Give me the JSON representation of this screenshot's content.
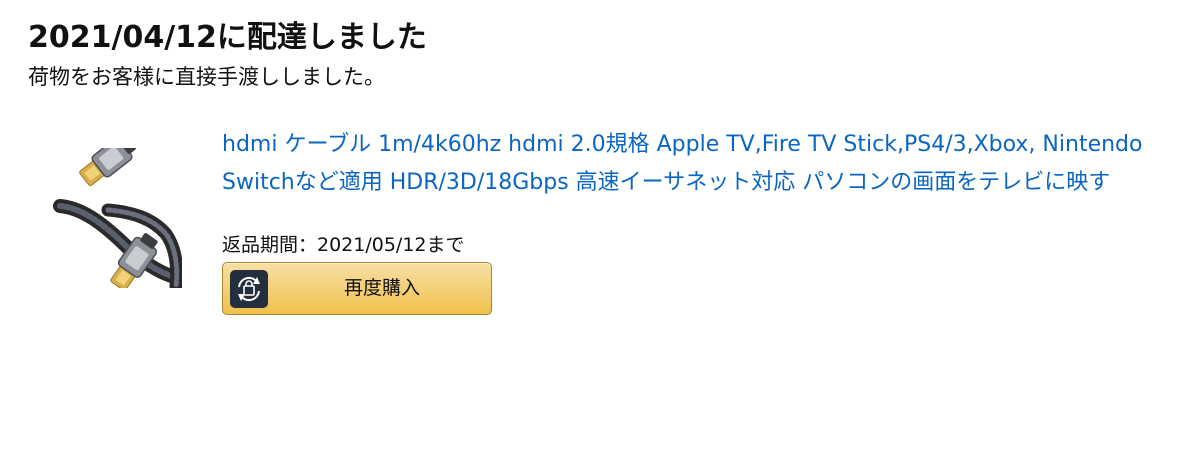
{
  "delivery": {
    "title": "2021/04/12に配達しました",
    "subtitle": "荷物をお客様に直接手渡ししました。"
  },
  "item": {
    "image_icon": "hdmi-cable-product-image",
    "title": "hdmi ケーブル 1m/4k60hz hdmi 2.0規格 Apple TV,Fire TV Stick,PS4/3,Xbox, Nintendo Switchなど適用 HDR/3D/18Gbps 高速イーサネット対応 パソコンの画面をテレビに映す",
    "return_period": "返品期間：2021/05/12まで",
    "rebuy_button": {
      "label": "再度購入",
      "icon": "buy-again-icon"
    }
  },
  "colors": {
    "link": "#0a66c2",
    "button_top": "#f7dfa5",
    "button_bottom": "#f0c14b",
    "button_border": "#a88734",
    "icon_bg": "#232f3e"
  }
}
